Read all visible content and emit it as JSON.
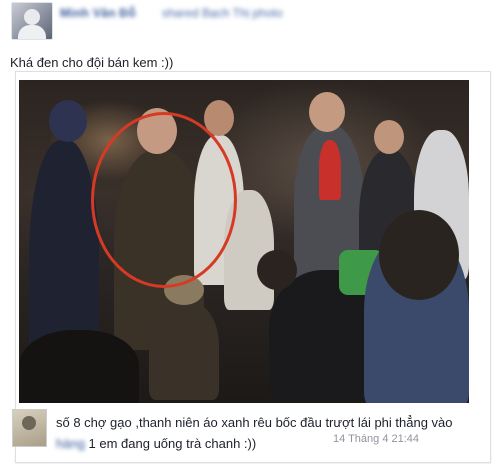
{
  "post": {
    "poster_name": "Minh Văn Đỗ",
    "poster_meta": "shared Bạch Thị photo",
    "text": "Khá đen cho đội bán kem :))"
  },
  "comment": {
    "text_main": "số 8 chợ gạo ,thanh niên áo xanh rêu bốc đầu trượt lái phi thẳng vào",
    "text_line2_blurred": "hàng",
    "text_line2": " 1 em đang uống trà chanh :))",
    "timestamp": "14 Tháng 4 21:44"
  },
  "colors": {
    "link": "#365899",
    "circle": "#d63a25",
    "meta_text": "#90949c"
  }
}
